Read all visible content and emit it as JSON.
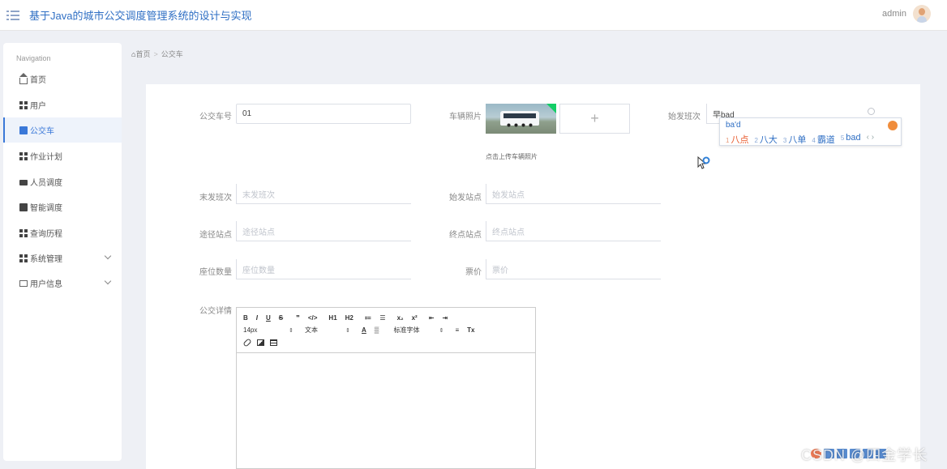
{
  "header": {
    "title": "基于Java的城市公交调度管理系统的设计与实现",
    "username": "admin"
  },
  "sidebar": {
    "nav_title": "Navigation",
    "items": [
      {
        "label": "首页",
        "icon": "home-icon"
      },
      {
        "label": "用户",
        "icon": "grid-icon"
      },
      {
        "label": "公交车",
        "icon": "chat-icon",
        "active": true
      },
      {
        "label": "作业计划",
        "icon": "grid-icon"
      },
      {
        "label": "人员调度",
        "icon": "briefcase-icon"
      },
      {
        "label": "智能调度",
        "icon": "check-icon"
      },
      {
        "label": "查询历程",
        "icon": "grid-icon"
      },
      {
        "label": "系统管理",
        "icon": "grid-icon",
        "expandable": true
      },
      {
        "label": "用户信息",
        "icon": "card-icon",
        "expandable": true
      }
    ]
  },
  "breadcrumb": {
    "home": "首页",
    "separator": ">",
    "current": "公交车"
  },
  "form": {
    "bus_number": {
      "label": "公交车号",
      "value": "01"
    },
    "vehicle_photo": {
      "label": "车辆照片",
      "hint": "点击上传车辆照片",
      "add_symbol": "+"
    },
    "first_shift": {
      "label": "始发班次",
      "value": "早bad"
    },
    "last_shift": {
      "label": "末发班次",
      "placeholder": "末发班次"
    },
    "start_station": {
      "label": "始发站点",
      "placeholder": "始发站点"
    },
    "via_stations": {
      "label": "途径站点",
      "placeholder": "途径站点"
    },
    "end_station": {
      "label": "终点站点",
      "placeholder": "终点站点"
    },
    "seat_count": {
      "label": "座位数量",
      "placeholder": "座位数量"
    },
    "fare": {
      "label": "票价",
      "placeholder": "票价"
    },
    "details": {
      "label": "公交详情"
    }
  },
  "ime": {
    "composition": "ba'd",
    "candidates": [
      {
        "index": "1",
        "text": "八点"
      },
      {
        "index": "2",
        "text": "八大"
      },
      {
        "index": "3",
        "text": "八单"
      },
      {
        "index": "4",
        "text": "霸道"
      },
      {
        "index": "5",
        "text": "bad"
      }
    ],
    "nav": "‹ ›"
  },
  "editor": {
    "row1": [
      "B",
      "I",
      "U",
      "S",
      "❞",
      "</>",
      "H1",
      "H2",
      "≔",
      "☰",
      "x₂",
      "x²",
      "⇤",
      "⇥"
    ],
    "font_size": "14px",
    "block_type": "文本",
    "font_family": "标准字体",
    "select_arrows": "⇕",
    "color_btn": "A",
    "bg_btn": "▒",
    "align_btn": "≡",
    "clear_btn": "Tx"
  },
  "watermark": "CSDN @四金学长",
  "colors": {
    "accent": "#3a78d8",
    "title": "#2f6fc4",
    "upload_badge": "#13ce66"
  }
}
